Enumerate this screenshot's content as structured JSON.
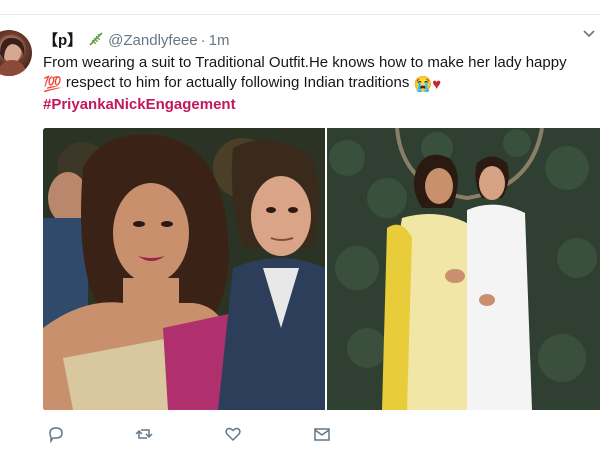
{
  "tweet": {
    "avatar_icon": "user-avatar",
    "display_name": "【p】",
    "name_icon": "leaf-icon",
    "handle": "@Zandlyfeee",
    "separator": "·",
    "timestamp": "1m",
    "text_line1": "From wearing a suit to Traditional Outfit.He knows how to make her lady happy",
    "emoji_100": "💯",
    "text_line2": "respect to him for actually following Indian traditions",
    "emoji_cry": "😭",
    "emoji_heart": "♥",
    "hashtag": "#PriyankaNickEngagement"
  },
  "media": {
    "photo_left": "engagement photo, couple in sari and suit",
    "photo_right": "engagement photo, couple in traditional outfits"
  },
  "actions": {
    "reply_icon": "reply-icon",
    "retweet_icon": "retweet-icon",
    "like_icon": "heart-icon",
    "dm_icon": "envelope-icon"
  },
  "colors": {
    "hashtag": "#c2185b",
    "muted": "#657786",
    "heart": "#c62828"
  }
}
